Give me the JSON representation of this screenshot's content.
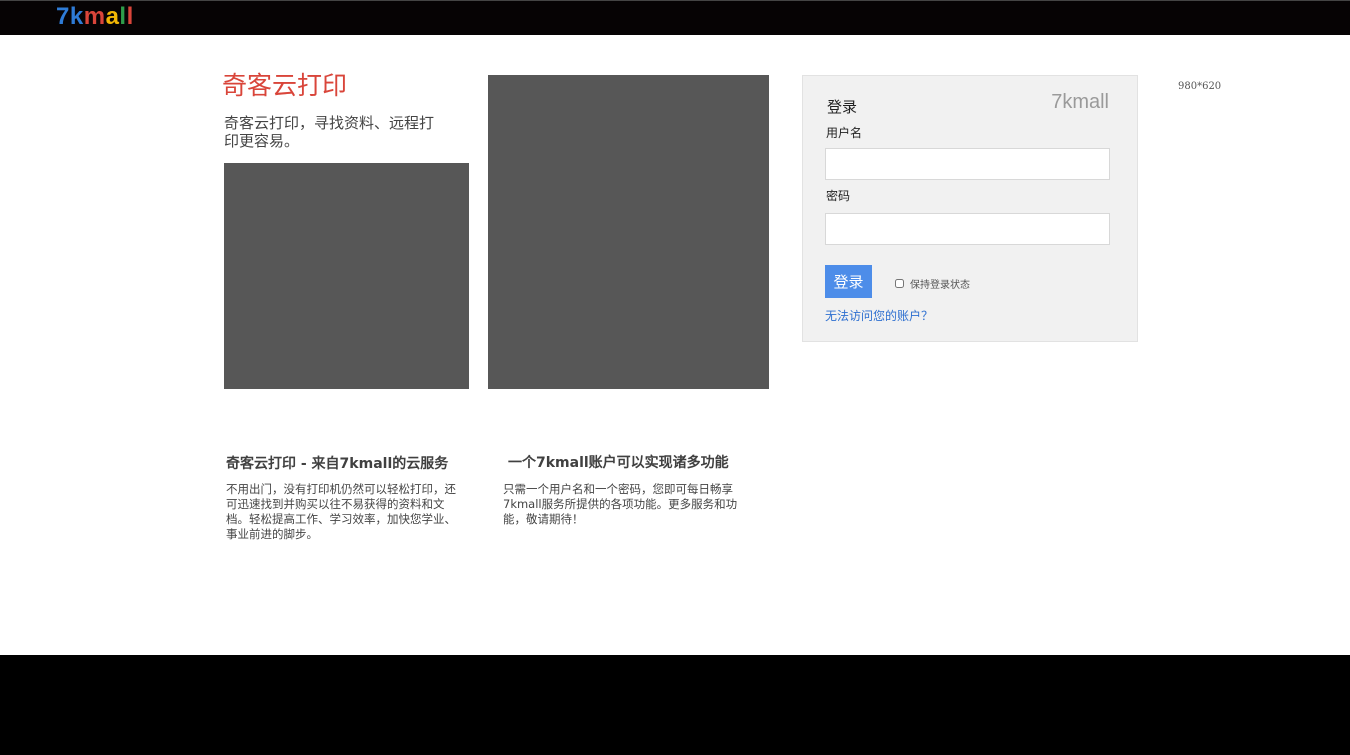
{
  "header": {
    "logo": [
      {
        "ch": "7",
        "color": "#2e7bd6"
      },
      {
        "ch": "k",
        "color": "#2e7bd6"
      },
      {
        "ch": "m",
        "color": "#d9453a"
      },
      {
        "ch": "a",
        "color": "#f2b705"
      },
      {
        "ch": "l",
        "color": "#2e9d4a"
      },
      {
        "ch": "l",
        "color": "#d9453a"
      }
    ]
  },
  "intro": {
    "title": "奇客云打印",
    "tagline": "奇客云打印，寻找资料、远程打印更容易。"
  },
  "features": [
    {
      "title": "奇客云打印 - 来自7kmall的云服务",
      "text": "不用出门，没有打印机仍然可以轻松打印，还可迅速找到并购买以往不易获得的资料和文档。轻松提高工作、学习效率，加快您学业、事业前进的脚步。"
    },
    {
      "title": "一个7kmall账户可以实现诸多功能",
      "text": "只需一个用户名和一个密码，您即可每日畅享7kmall服务所提供的各项功能。更多服务和功能，敬请期待！"
    }
  ],
  "login": {
    "heading": "登录",
    "brand": "7kmall",
    "username_label": "用户名",
    "username_value": "",
    "password_label": "密码",
    "password_value": "",
    "submit_label": "登录",
    "remember_label": "保持登录状态",
    "remember_checked": false,
    "help_link": "无法访问您的账户？"
  },
  "dims_note": "980*620",
  "colors": {
    "accent_red": "#d9453a",
    "button_blue": "#4d8de9",
    "link_blue": "#2d6fd0",
    "placeholder_gray": "#575757"
  }
}
